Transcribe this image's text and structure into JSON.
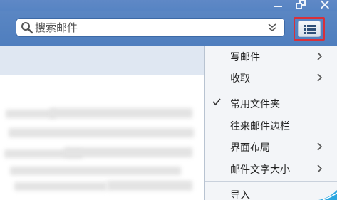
{
  "search": {
    "placeholder": "搜索邮件"
  },
  "menu": {
    "items": [
      {
        "label": "写邮件",
        "submenu": true,
        "checked": false
      },
      {
        "label": "收取",
        "submenu": true,
        "checked": false
      },
      {
        "label": "常用文件夹",
        "submenu": false,
        "checked": true
      },
      {
        "label": "往来邮件边栏",
        "submenu": false,
        "checked": false
      },
      {
        "label": "界面布局",
        "submenu": true,
        "checked": false
      },
      {
        "label": "邮件文字大小",
        "submenu": true,
        "checked": false
      },
      {
        "label": "导入",
        "submenu": false,
        "checked": false
      }
    ]
  },
  "icons": {
    "minimize": "minimize-icon",
    "restore": "restore-icon",
    "close": "close-icon",
    "search": "search-icon",
    "dropdown": "double-chevron-down-icon",
    "menu": "list-menu-icon",
    "check": "check-icon",
    "submenu_arrow": "chevron-right-icon"
  },
  "colors": {
    "titlebar": "#5684c3",
    "highlight_border": "#d8303a",
    "menu_background": "#f3f5f8"
  }
}
